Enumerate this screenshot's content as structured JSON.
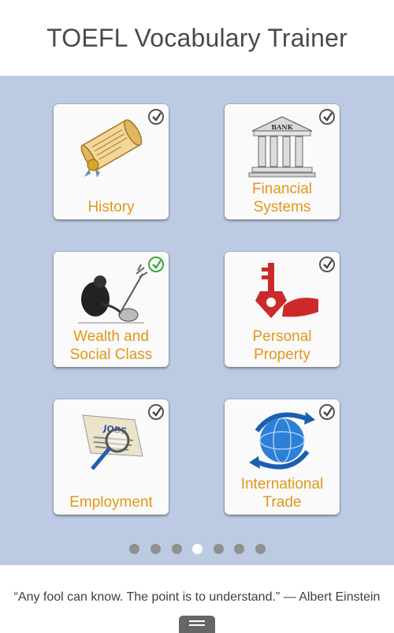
{
  "header": {
    "title": "TOEFL Vocabulary Trainer"
  },
  "topics": [
    {
      "label": "History",
      "icon": "scroll-icon",
      "completed": false
    },
    {
      "label": "Financial Systems",
      "icon": "bank-icon",
      "completed": false
    },
    {
      "label": "Wealth and Social Class",
      "icon": "wealth-icon",
      "completed": true
    },
    {
      "label": "Personal Property",
      "icon": "key-hand-icon",
      "completed": false
    },
    {
      "label": "Employment",
      "icon": "jobs-newspaper-icon",
      "completed": false
    },
    {
      "label": "International Trade",
      "icon": "globe-arrows-icon",
      "completed": false
    }
  ],
  "pager": {
    "count": 7,
    "active_index": 3
  },
  "footer": {
    "quote": "“Any fool can know. The point is to understand.” — Albert Einstein"
  },
  "colors": {
    "accent": "#e4961a",
    "panel": "#bccbe3",
    "check_done": "#3aa83a"
  }
}
